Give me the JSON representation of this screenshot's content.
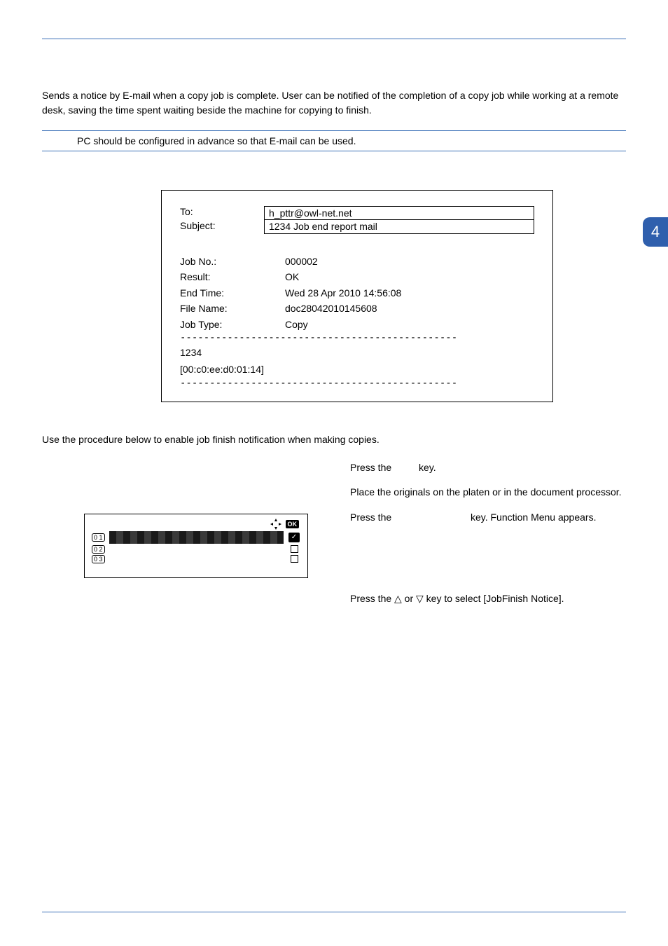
{
  "intro": "Sends a notice by E-mail when a copy job is complete. User can be notified of the completion of a copy job while working at a remote desk, saving the time spent waiting beside the machine for copying to finish.",
  "note": "PC should be configured in advance so that E-mail can be used.",
  "tab_number": "4",
  "email": {
    "to_label": "To:",
    "to_value": "h_pttr@owl-net.net",
    "subject_label": "Subject:",
    "subject_value": "1234 Job end report mail",
    "fields": [
      {
        "label": "Job No.:",
        "value": "000002"
      },
      {
        "label": "Result:",
        "value": "OK"
      },
      {
        "label": "End Time:",
        "value": "Wed 28 Apr 2010 14:56:08"
      },
      {
        "label": "File Name:",
        "value": "doc28042010145608"
      },
      {
        "label": "Job Type:",
        "value": "Copy"
      }
    ],
    "dashes": "-----------------------------------------------",
    "sig1": "1234",
    "sig2": "[00:c0:ee:d0:01:14]"
  },
  "instruction": "Use the procedure below to enable job finish notification when making copies.",
  "steps": {
    "s1a": "Press the ",
    "s1b": " key.",
    "s2": "Place the originals on the platen or in the document processor.",
    "s3a": "Press the ",
    "s3b": " key. Function Menu appears.",
    "s4": "Press the △ or ▽ key to select [JobFinish Notice]."
  },
  "panel": {
    "ok": "OK",
    "n1": "0 1",
    "n2": "0 2",
    "n3": "0 3",
    "check": "✓"
  }
}
